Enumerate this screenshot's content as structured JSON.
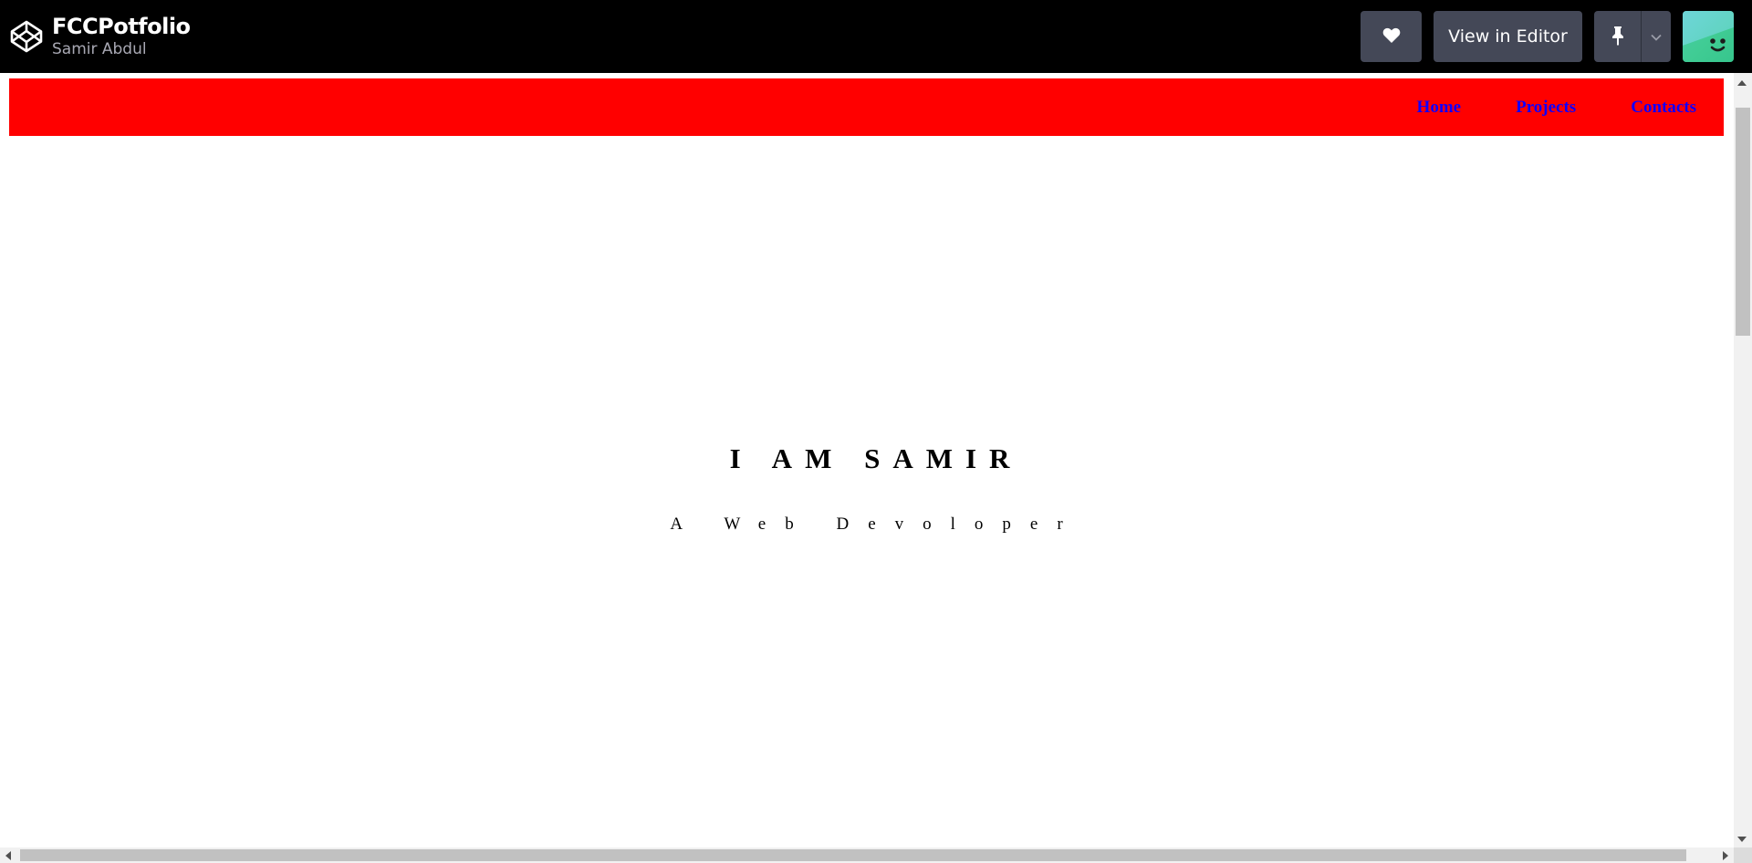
{
  "codepen": {
    "pen_title": "FCCPotfolio",
    "author": "Samir Abdul",
    "heart_icon": "heart-icon",
    "view_in_editor_label": "View in Editor",
    "pin_icon": "pin-icon",
    "dropdown_icon": "chevron-down-icon",
    "logo_icon": "codepen-logo-icon"
  },
  "site": {
    "nav": {
      "background": "#ff0000",
      "link_color": "#1000ff",
      "links": [
        "Home",
        "Projects",
        "Contacts"
      ]
    },
    "hero": {
      "title": "I AM SAMIR",
      "subtitle": "A Web Devoloper"
    }
  }
}
